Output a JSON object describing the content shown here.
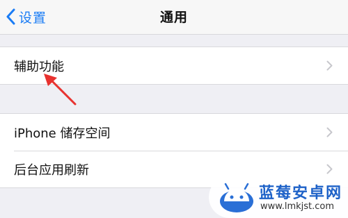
{
  "navbar": {
    "back_label": "设置",
    "title": "通用"
  },
  "group1": {
    "items": [
      {
        "label": "辅助功能"
      }
    ]
  },
  "group2": {
    "items": [
      {
        "label": "iPhone 储存空间"
      },
      {
        "label": "后台应用刷新"
      }
    ]
  },
  "watermark": {
    "title": "蓝莓安卓网",
    "url": "www.lmkjst.com",
    "icon": "android-robot-icon"
  },
  "colors": {
    "accent": "#1a7cf5",
    "background": "#efeff4",
    "chevron": "#c7c7cc",
    "annotation_arrow": "#e8322f",
    "watermark_brand": "#1e62c8"
  }
}
